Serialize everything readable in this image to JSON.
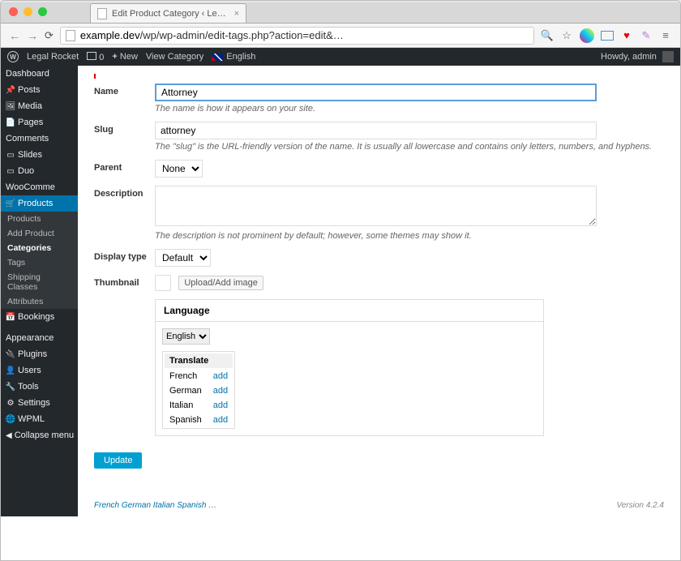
{
  "browser": {
    "tab_title": "Edit Product Category ‹ Le…",
    "url_display": "example.dev/wp/wp-admin/edit-tags.php?action=edit&…"
  },
  "adminbar": {
    "site_name": "Legal Rocket",
    "comment_count": "0",
    "new_label": "New",
    "view_label": "View Category",
    "language": "English",
    "howdy": "Howdy, admin"
  },
  "sidebar": {
    "items": [
      {
        "label": "Dashboard",
        "icon": "🏠"
      },
      {
        "label": "Posts",
        "icon": "📌"
      },
      {
        "label": "Media",
        "icon": "🖼"
      },
      {
        "label": "Pages",
        "icon": "📄"
      },
      {
        "label": "Comments",
        "icon": "💬"
      },
      {
        "label": "Slides",
        "icon": "▭"
      },
      {
        "label": "Duo",
        "icon": "▭"
      },
      {
        "label": "WooComme",
        "icon": ""
      },
      {
        "label": "Products",
        "icon": "🛒",
        "current": true
      }
    ],
    "submenu": [
      {
        "label": "Products"
      },
      {
        "label": "Add Product"
      },
      {
        "label": "Categories",
        "current": true
      },
      {
        "label": "Tags"
      },
      {
        "label": "Shipping Classes"
      },
      {
        "label": "Attributes"
      }
    ],
    "items2": [
      {
        "label": "Bookings",
        "icon": "📅"
      },
      {
        "label": "Appearance",
        "icon": "🎨"
      },
      {
        "label": "Plugins",
        "icon": "🔌"
      },
      {
        "label": "Users",
        "icon": "👤"
      },
      {
        "label": "Tools",
        "icon": "🔧"
      },
      {
        "label": "Settings",
        "icon": "⚙"
      },
      {
        "label": "WPML",
        "icon": "🌐"
      },
      {
        "label": "Collapse menu",
        "icon": "◀"
      }
    ]
  },
  "form": {
    "name": {
      "label": "Name",
      "value": "Attorney",
      "desc": "The name is how it appears on your site."
    },
    "slug": {
      "label": "Slug",
      "value": "attorney",
      "desc": "The \"slug\" is the URL-friendly version of the name. It is usually all lowercase and contains only letters, numbers, and hyphens."
    },
    "parent": {
      "label": "Parent",
      "value": "None"
    },
    "description": {
      "label": "Description",
      "value": "",
      "desc": "The description is not prominent by default; however, some themes may show it."
    },
    "display_type": {
      "label": "Display type",
      "value": "Default"
    },
    "thumbnail": {
      "label": "Thumbnail",
      "button": "Upload/Add image"
    },
    "language": {
      "header": "Language",
      "selected": "English",
      "translate_header": "Translate",
      "rows": [
        {
          "lang": "French",
          "action": "add"
        },
        {
          "lang": "German",
          "action": "add"
        },
        {
          "lang": "Italian",
          "action": "add"
        },
        {
          "lang": "Spanish",
          "action": "add"
        }
      ]
    },
    "update_button": "Update"
  },
  "footer": {
    "version": "Version 4.2.4"
  }
}
